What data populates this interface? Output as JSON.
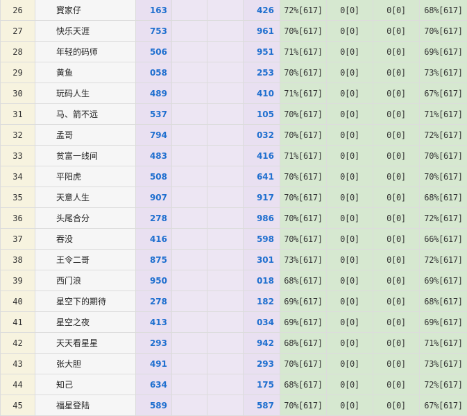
{
  "rows": [
    {
      "no": "26",
      "name": "寳家仔",
      "n1": "163",
      "n2": "426",
      "s1": "72%[617]",
      "s2": "0[0]",
      "s3": "0[0]",
      "s4": "68%[617]"
    },
    {
      "no": "27",
      "name": "快乐天涯",
      "n1": "753",
      "n2": "961",
      "s1": "70%[617]",
      "s2": "0[0]",
      "s3": "0[0]",
      "s4": "70%[617]"
    },
    {
      "no": "28",
      "name": "年轻的码师",
      "n1": "506",
      "n2": "951",
      "s1": "71%[617]",
      "s2": "0[0]",
      "s3": "0[0]",
      "s4": "69%[617]"
    },
    {
      "no": "29",
      "name": "黄鱼",
      "n1": "058",
      "n2": "253",
      "s1": "70%[617]",
      "s2": "0[0]",
      "s3": "0[0]",
      "s4": "73%[617]"
    },
    {
      "no": "30",
      "name": "玩码人生",
      "n1": "489",
      "n2": "410",
      "s1": "71%[617]",
      "s2": "0[0]",
      "s3": "0[0]",
      "s4": "67%[617]"
    },
    {
      "no": "31",
      "name": "马、箭不远",
      "n1": "537",
      "n2": "105",
      "s1": "70%[617]",
      "s2": "0[0]",
      "s3": "0[0]",
      "s4": "71%[617]"
    },
    {
      "no": "32",
      "name": "孟哥",
      "n1": "794",
      "n2": "032",
      "s1": "70%[617]",
      "s2": "0[0]",
      "s3": "0[0]",
      "s4": "72%[617]"
    },
    {
      "no": "33",
      "name": "贫富一线间",
      "n1": "483",
      "n2": "416",
      "s1": "71%[617]",
      "s2": "0[0]",
      "s3": "0[0]",
      "s4": "70%[617]"
    },
    {
      "no": "34",
      "name": "平阳虎",
      "n1": "508",
      "n2": "641",
      "s1": "70%[617]",
      "s2": "0[0]",
      "s3": "0[0]",
      "s4": "70%[617]"
    },
    {
      "no": "35",
      "name": "天意人生",
      "n1": "907",
      "n2": "917",
      "s1": "70%[617]",
      "s2": "0[0]",
      "s3": "0[0]",
      "s4": "68%[617]"
    },
    {
      "no": "36",
      "name": "头尾合分",
      "n1": "278",
      "n2": "986",
      "s1": "70%[617]",
      "s2": "0[0]",
      "s3": "0[0]",
      "s4": "72%[617]"
    },
    {
      "no": "37",
      "name": "吞没",
      "n1": "416",
      "n2": "598",
      "s1": "70%[617]",
      "s2": "0[0]",
      "s3": "0[0]",
      "s4": "66%[617]"
    },
    {
      "no": "38",
      "name": "王令二哥",
      "n1": "875",
      "n2": "301",
      "s1": "73%[617]",
      "s2": "0[0]",
      "s3": "0[0]",
      "s4": "72%[617]"
    },
    {
      "no": "39",
      "name": "西门浪",
      "n1": "950",
      "n2": "018",
      "s1": "68%[617]",
      "s2": "0[0]",
      "s3": "0[0]",
      "s4": "69%[617]"
    },
    {
      "no": "40",
      "name": "星空下的期待",
      "n1": "278",
      "n2": "182",
      "s1": "69%[617]",
      "s2": "0[0]",
      "s3": "0[0]",
      "s4": "68%[617]"
    },
    {
      "no": "41",
      "name": "星空之夜",
      "n1": "413",
      "n2": "034",
      "s1": "69%[617]",
      "s2": "0[0]",
      "s3": "0[0]",
      "s4": "69%[617]"
    },
    {
      "no": "42",
      "name": "天天看星星",
      "n1": "293",
      "n2": "942",
      "s1": "68%[617]",
      "s2": "0[0]",
      "s3": "0[0]",
      "s4": "71%[617]"
    },
    {
      "no": "43",
      "name": "张大胆",
      "n1": "491",
      "n2": "293",
      "s1": "70%[617]",
      "s2": "0[0]",
      "s3": "0[0]",
      "s4": "73%[617]"
    },
    {
      "no": "44",
      "name": "知己",
      "n1": "634",
      "n2": "175",
      "s1": "68%[617]",
      "s2": "0[0]",
      "s3": "0[0]",
      "s4": "72%[617]"
    },
    {
      "no": "45",
      "name": "福星登陆",
      "n1": "589",
      "n2": "587",
      "s1": "70%[617]",
      "s2": "0[0]",
      "s3": "0[0]",
      "s4": "67%[617]"
    }
  ]
}
